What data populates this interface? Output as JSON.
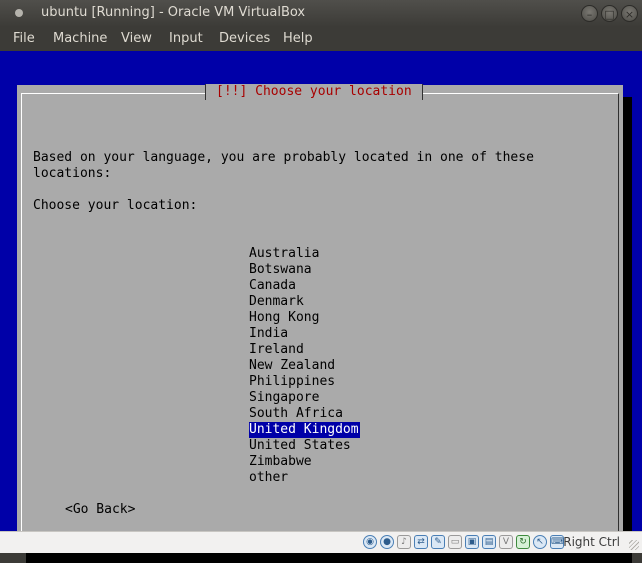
{
  "window": {
    "title": "ubuntu [Running] - Oracle VM VirtualBox"
  },
  "menu": {
    "file": "File",
    "machine": "Machine",
    "view": "View",
    "input": "Input",
    "devices": "Devices",
    "help": "Help"
  },
  "installer": {
    "dialog_title": "[!!] Choose your location",
    "description_line1": "Based on your language, you are probably located in one of these",
    "description_line2": "locations:",
    "prompt": "Choose your location:",
    "locations": [
      "Australia",
      "Botswana",
      "Canada",
      "Denmark",
      "Hong Kong",
      "India",
      "Ireland",
      "New Zealand",
      "Philippines",
      "Singapore",
      "South Africa",
      "United Kingdom",
      "United States",
      "Zimbabwe",
      "other"
    ],
    "selected": "United Kingdom",
    "go_back": "<Go Back>"
  },
  "statusbar": {
    "host_key": "Right Ctrl",
    "icons": [
      "hard-disk-icon",
      "optical-drive-icon",
      "audio-icon",
      "network-icon",
      "usb-icon",
      "shared-folders-icon",
      "display-icon",
      "video-capture-icon",
      "virtualization-icon",
      "cpu-icon",
      "mouse-integration-icon",
      "keyboard-icon"
    ]
  },
  "colors": {
    "vm_background": "#0000a8",
    "dialog_background": "#aaaaaa",
    "dialog_title": "#a80000",
    "selection": "#0000a8"
  }
}
